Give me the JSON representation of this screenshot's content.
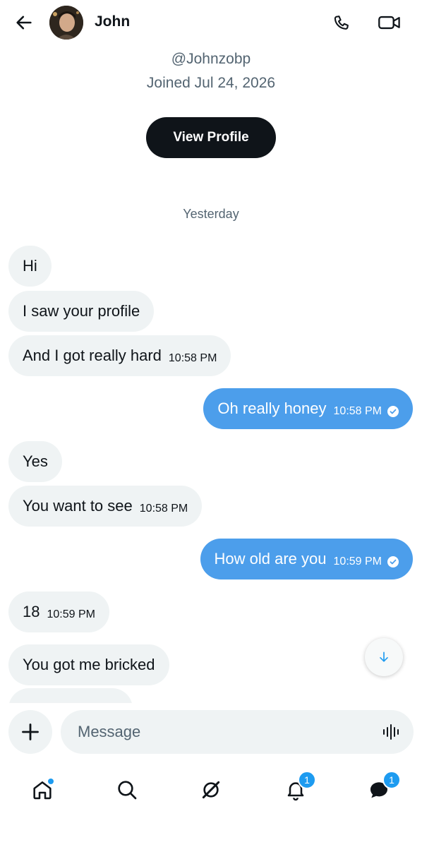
{
  "header": {
    "name": "John"
  },
  "profile": {
    "handle": "@Johnzobp",
    "joined": "Joined Jul 24, 2026",
    "view_profile_label": "View Profile"
  },
  "date_separator": "Yesterday",
  "messages": [
    {
      "dir": "in",
      "text": "Hi"
    },
    {
      "dir": "in",
      "text": "I saw your profile"
    },
    {
      "dir": "in",
      "text": "And I got really hard",
      "time": "10:58 PM"
    },
    {
      "dir": "out",
      "text": "Oh really honey",
      "time": "10:58 PM"
    },
    {
      "dir": "in",
      "text": "Yes"
    },
    {
      "dir": "in",
      "text": "You want to see",
      "time": "10:58 PM"
    },
    {
      "dir": "out",
      "text": "How old are you",
      "time": "10:59 PM"
    },
    {
      "dir": "in",
      "text": "18",
      "time": "10:59 PM"
    },
    {
      "dir": "in",
      "text": "You got me bricked"
    }
  ],
  "composer": {
    "placeholder": "Message"
  },
  "nav": {
    "notifications_badge": "1",
    "messages_badge": "1"
  },
  "colors": {
    "accent": "#1d9bf0",
    "outgoing_bubble": "#4c9eeb",
    "incoming_bubble": "#eff3f4"
  }
}
